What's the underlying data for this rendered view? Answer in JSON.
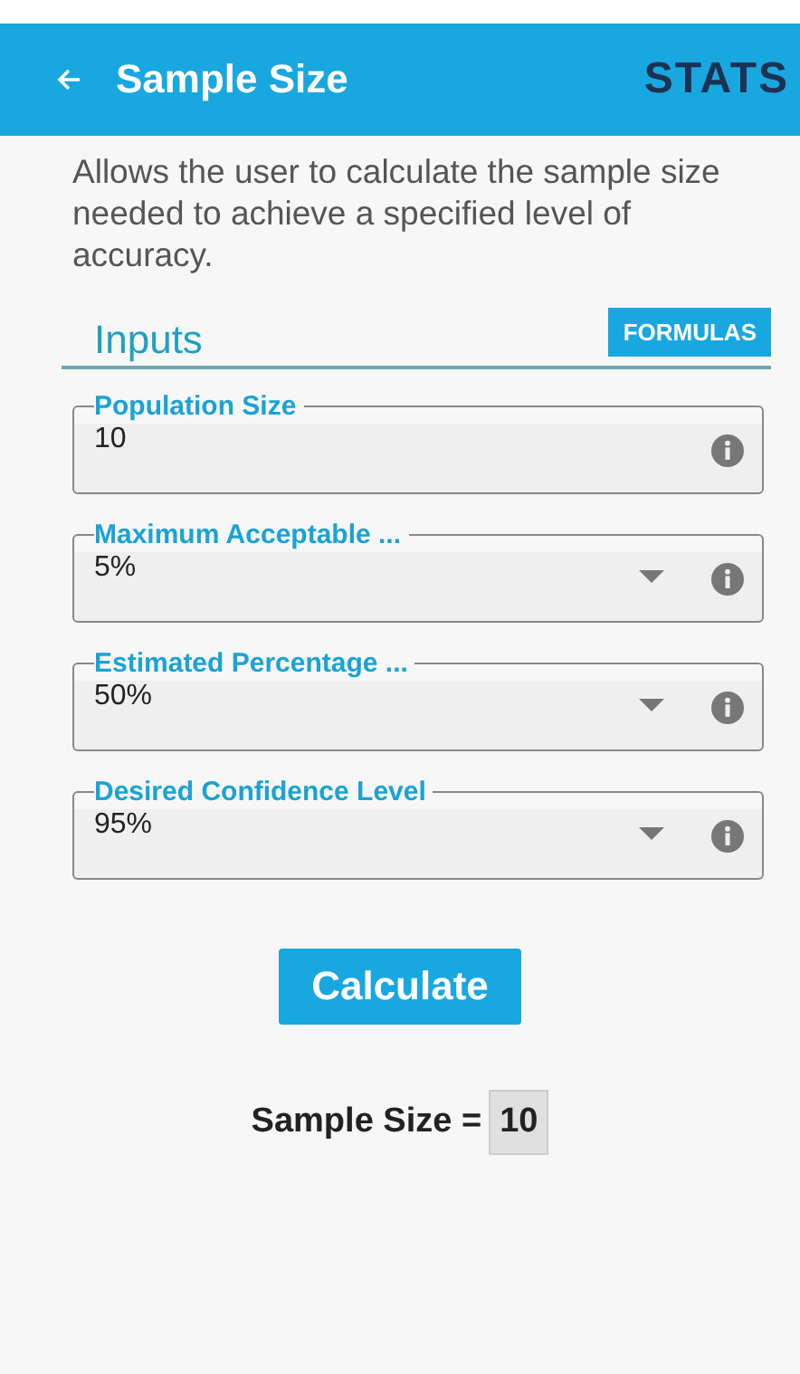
{
  "app_bar": {
    "title": "Sample Size",
    "logo": "STATS"
  },
  "description": "Allows the user to calculate the sample size needed to achieve a specified level of accuracy.",
  "section": {
    "title": "Inputs",
    "button": "FORMULAS"
  },
  "fields": [
    {
      "kind": "text",
      "label": "Population Size",
      "value": "10"
    },
    {
      "kind": "dropdown",
      "label": "Maximum Acceptable ...",
      "value": "5%"
    },
    {
      "kind": "dropdown",
      "label": "Estimated Percentage ...",
      "value": "50%"
    },
    {
      "kind": "dropdown",
      "label": "Desired Confidence Level",
      "value": "95%"
    }
  ],
  "calculate_button": "Calculate",
  "result": {
    "label": "Sample Size =",
    "value": "10"
  }
}
